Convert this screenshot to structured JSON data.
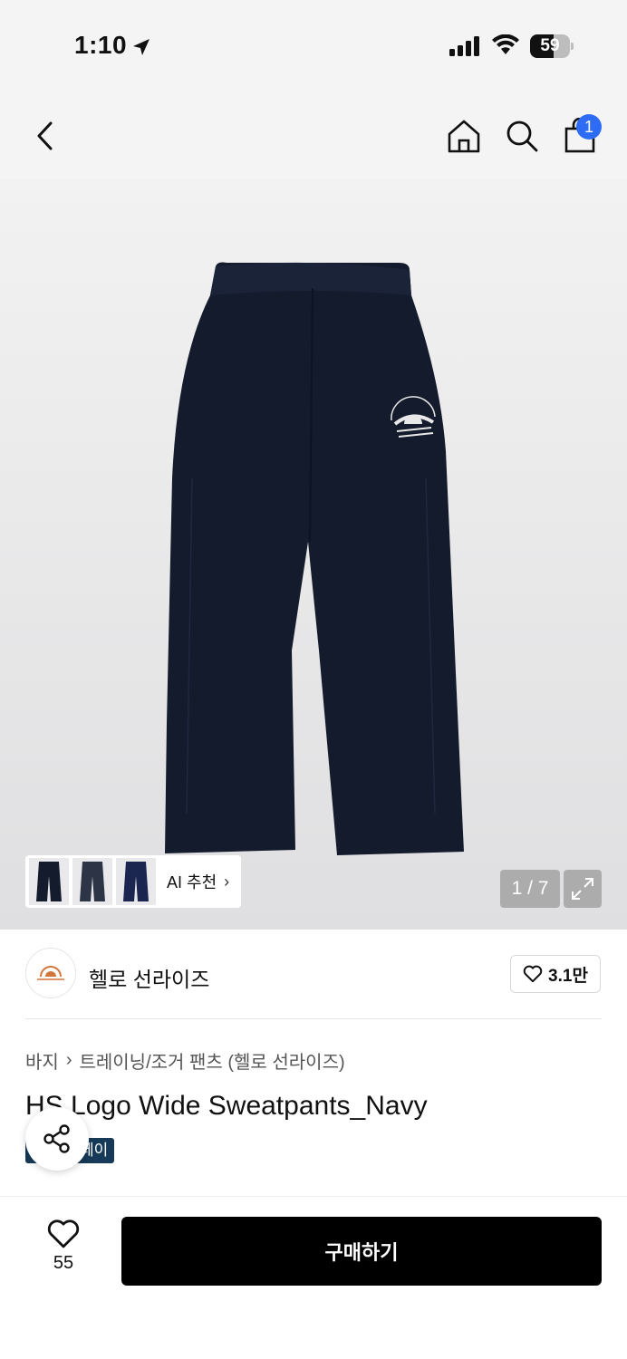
{
  "status_bar": {
    "time": "1:10",
    "battery": "59",
    "battery_level": 0.59
  },
  "nav": {
    "cart_count": "1"
  },
  "gallery": {
    "page_counter": "1 / 7",
    "ai_label": "AI 추천",
    "chevron": "›"
  },
  "brand": {
    "name": "헬로 선라이즈",
    "likes": "3.1만",
    "logo_alt": "HELLO SUNRISE"
  },
  "product": {
    "breadcrumb": [
      "바지",
      "트레이닝/조거 팬츠 (헬로 선라이즈)"
    ],
    "breadcrumb_sep": "›",
    "title": "HS Logo Wide Sweatpants_Navy",
    "tag": "페이"
  },
  "bottom": {
    "wish_count": "55",
    "buy_label": "구매하기"
  },
  "colors": {
    "accent_badge": "#2f6cf5",
    "navy": "#141b2d",
    "tag_bg": "#163a57"
  },
  "icons": [
    "back-icon",
    "home-icon",
    "search-icon",
    "cart-icon",
    "expand-icon",
    "heart-icon",
    "share-icon",
    "location-arrow-icon",
    "signal-icon",
    "wifi-icon"
  ]
}
